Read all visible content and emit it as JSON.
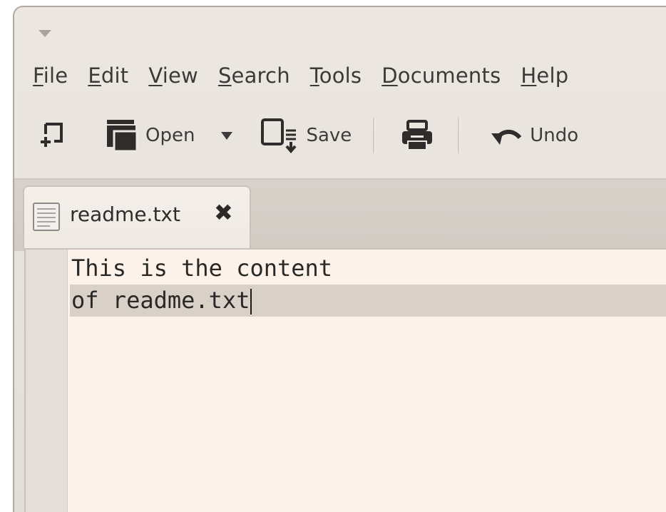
{
  "menubar": {
    "items": [
      {
        "mnemonic": "F",
        "rest": "ile"
      },
      {
        "mnemonic": "E",
        "rest": "dit"
      },
      {
        "mnemonic": "V",
        "rest": "iew"
      },
      {
        "mnemonic": "S",
        "rest": "earch"
      },
      {
        "mnemonic": "T",
        "rest": "ools"
      },
      {
        "mnemonic": "D",
        "rest": "ocuments"
      },
      {
        "mnemonic": "H",
        "rest": "elp"
      }
    ]
  },
  "toolbar": {
    "new_icon": "new-document-icon",
    "open_label": "Open",
    "open_icon": "open-folder-icon",
    "recent_icon": "dropdown-arrow-icon",
    "save_label": "Save",
    "save_icon": "save-icon",
    "print_icon": "printer-icon",
    "undo_label": "Undo",
    "undo_icon": "undo-icon"
  },
  "tabs": [
    {
      "label": "readme.txt",
      "icon": "text-document-icon",
      "close_icon": "close-icon"
    }
  ],
  "editor": {
    "lines": [
      "This is the content",
      "of readme.txt"
    ],
    "current_line": 2
  },
  "colors": {
    "editor_bg": "#fcf2e9",
    "current_line_bg": "#d9d0c8",
    "window_bg": "#ede7e1"
  }
}
